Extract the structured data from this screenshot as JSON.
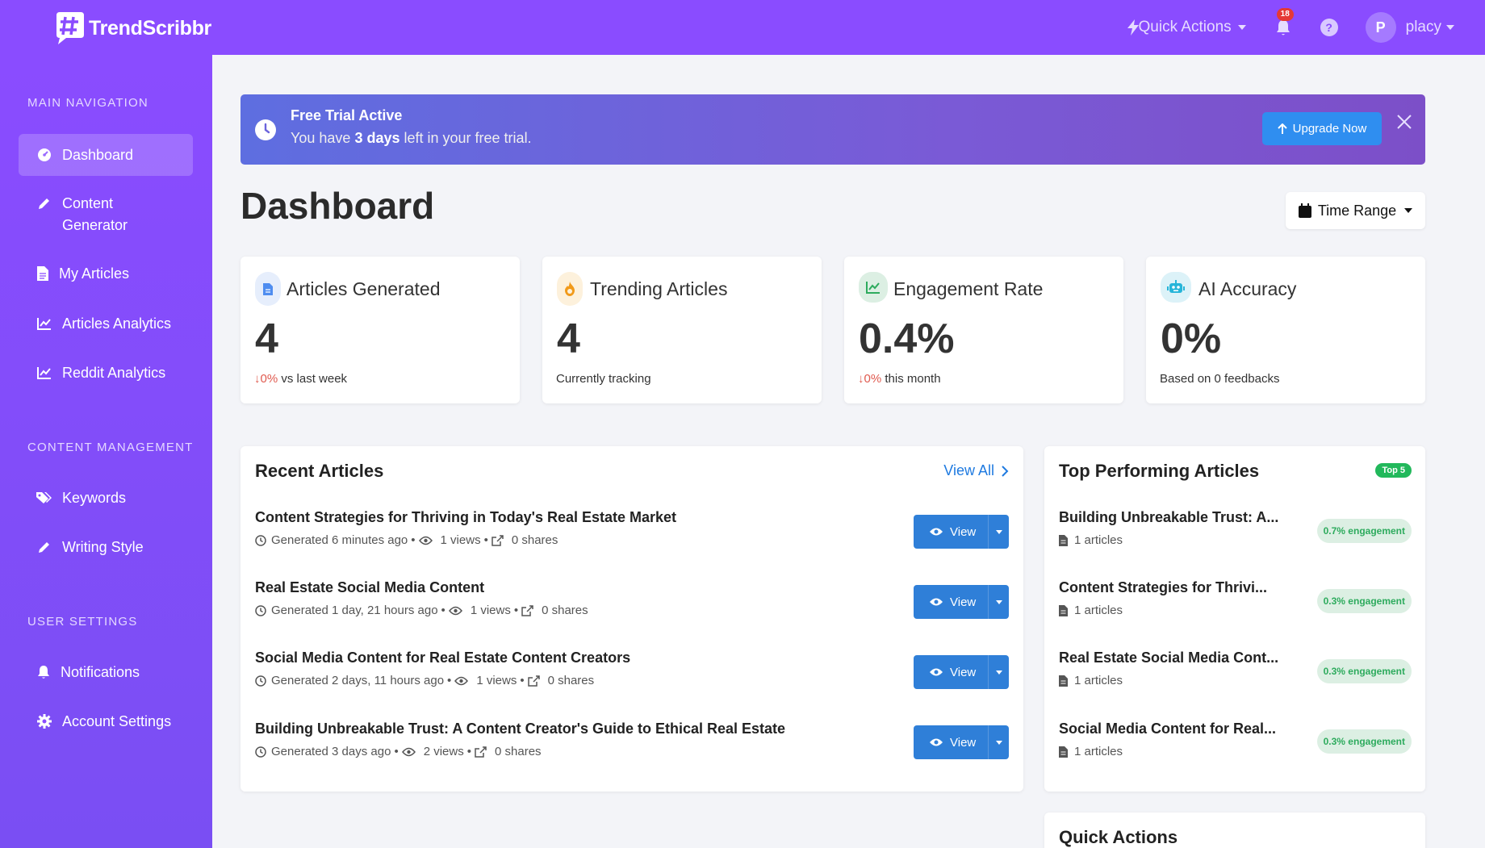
{
  "app": {
    "brand": "TrendScribbr"
  },
  "topbar": {
    "quick_actions": "Quick Actions",
    "notifications_count": "18",
    "help": "?",
    "avatar_initial": "P",
    "username": "placy"
  },
  "sidebar": {
    "sections": [
      {
        "label": "MAIN NAVIGATION",
        "items": [
          {
            "label": "Dashboard",
            "icon": "dashboard-icon",
            "active": true
          },
          {
            "label": "Content Generator",
            "icon": "pencil-icon"
          },
          {
            "label": "My Articles",
            "icon": "file-icon"
          },
          {
            "label": "Articles Analytics",
            "icon": "chart-line-icon"
          },
          {
            "label": "Reddit Analytics",
            "icon": "chart-line-icon"
          }
        ]
      },
      {
        "label": "CONTENT MANAGEMENT",
        "items": [
          {
            "label": "Keywords",
            "icon": "tags-icon"
          },
          {
            "label": "Writing Style",
            "icon": "pencil-icon"
          }
        ]
      },
      {
        "label": "USER SETTINGS",
        "items": [
          {
            "label": "Notifications",
            "icon": "bell-icon"
          },
          {
            "label": "Account Settings",
            "icon": "gear-icon"
          }
        ]
      }
    ]
  },
  "banner": {
    "title": "Free Trial Active",
    "text_prefix": "You have",
    "text_bold": "3 days",
    "text_suffix": "left in your free trial.",
    "upgrade_label": "Upgrade Now"
  },
  "page": {
    "title": "Dashboard",
    "time_range": "Time Range"
  },
  "stats": [
    {
      "title": "Articles Generated",
      "value": "4",
      "change": "0%",
      "sub": "vs last week",
      "icon": "file-icon",
      "color": "#4f8df0",
      "bg": "#e6eefc"
    },
    {
      "title": "Trending Articles",
      "value": "4",
      "change": "",
      "sub": "Currently tracking",
      "icon": "fire-icon",
      "color": "#f19a1a",
      "bg": "#fdf1dc"
    },
    {
      "title": "Engagement Rate",
      "value": "0.4%",
      "change": "0%",
      "sub": "this month",
      "icon": "chart-line-icon",
      "color": "#2dab5d",
      "bg": "#dcefe3"
    },
    {
      "title": "AI Accuracy",
      "value": "0%",
      "change": "",
      "sub": "Based on 0 feedbacks",
      "icon": "robot-icon",
      "color": "#26b5d9",
      "bg": "#dcf2f8"
    }
  ],
  "recent": {
    "title": "Recent Articles",
    "view_all": "View All",
    "view_label": "View",
    "articles": [
      {
        "title": "Content Strategies for Thriving in Today's Real Estate Market",
        "generated": "Generated 6 minutes ago",
        "views": "1 views",
        "shares": "0 shares"
      },
      {
        "title": "Real Estate Social Media Content",
        "generated": "Generated 1 day, 21 hours ago",
        "views": "1 views",
        "shares": "0 shares"
      },
      {
        "title": "Social Media Content for Real Estate Content Creators",
        "generated": "Generated 2 days, 11 hours ago",
        "views": "1 views",
        "shares": "0 shares"
      },
      {
        "title": "Building Unbreakable Trust: A Content Creator's Guide to Ethical Real Estate",
        "generated": "Generated 3 days ago",
        "views": "2 views",
        "shares": "0 shares"
      }
    ]
  },
  "top": {
    "title": "Top Performing Articles",
    "badge": "Top 5",
    "items": [
      {
        "title": "Building Unbreakable Trust: A...",
        "count": "1 articles",
        "engagement": "0.7% engagement"
      },
      {
        "title": "Content Strategies for Thrivi...",
        "count": "1 articles",
        "engagement": "0.3% engagement"
      },
      {
        "title": "Real Estate Social Media Cont...",
        "count": "1 articles",
        "engagement": "0.3% engagement"
      },
      {
        "title": "Social Media Content for Real...",
        "count": "1 articles",
        "engagement": "0.3% engagement"
      }
    ]
  },
  "quick_actions_card": {
    "title": "Quick Actions"
  }
}
